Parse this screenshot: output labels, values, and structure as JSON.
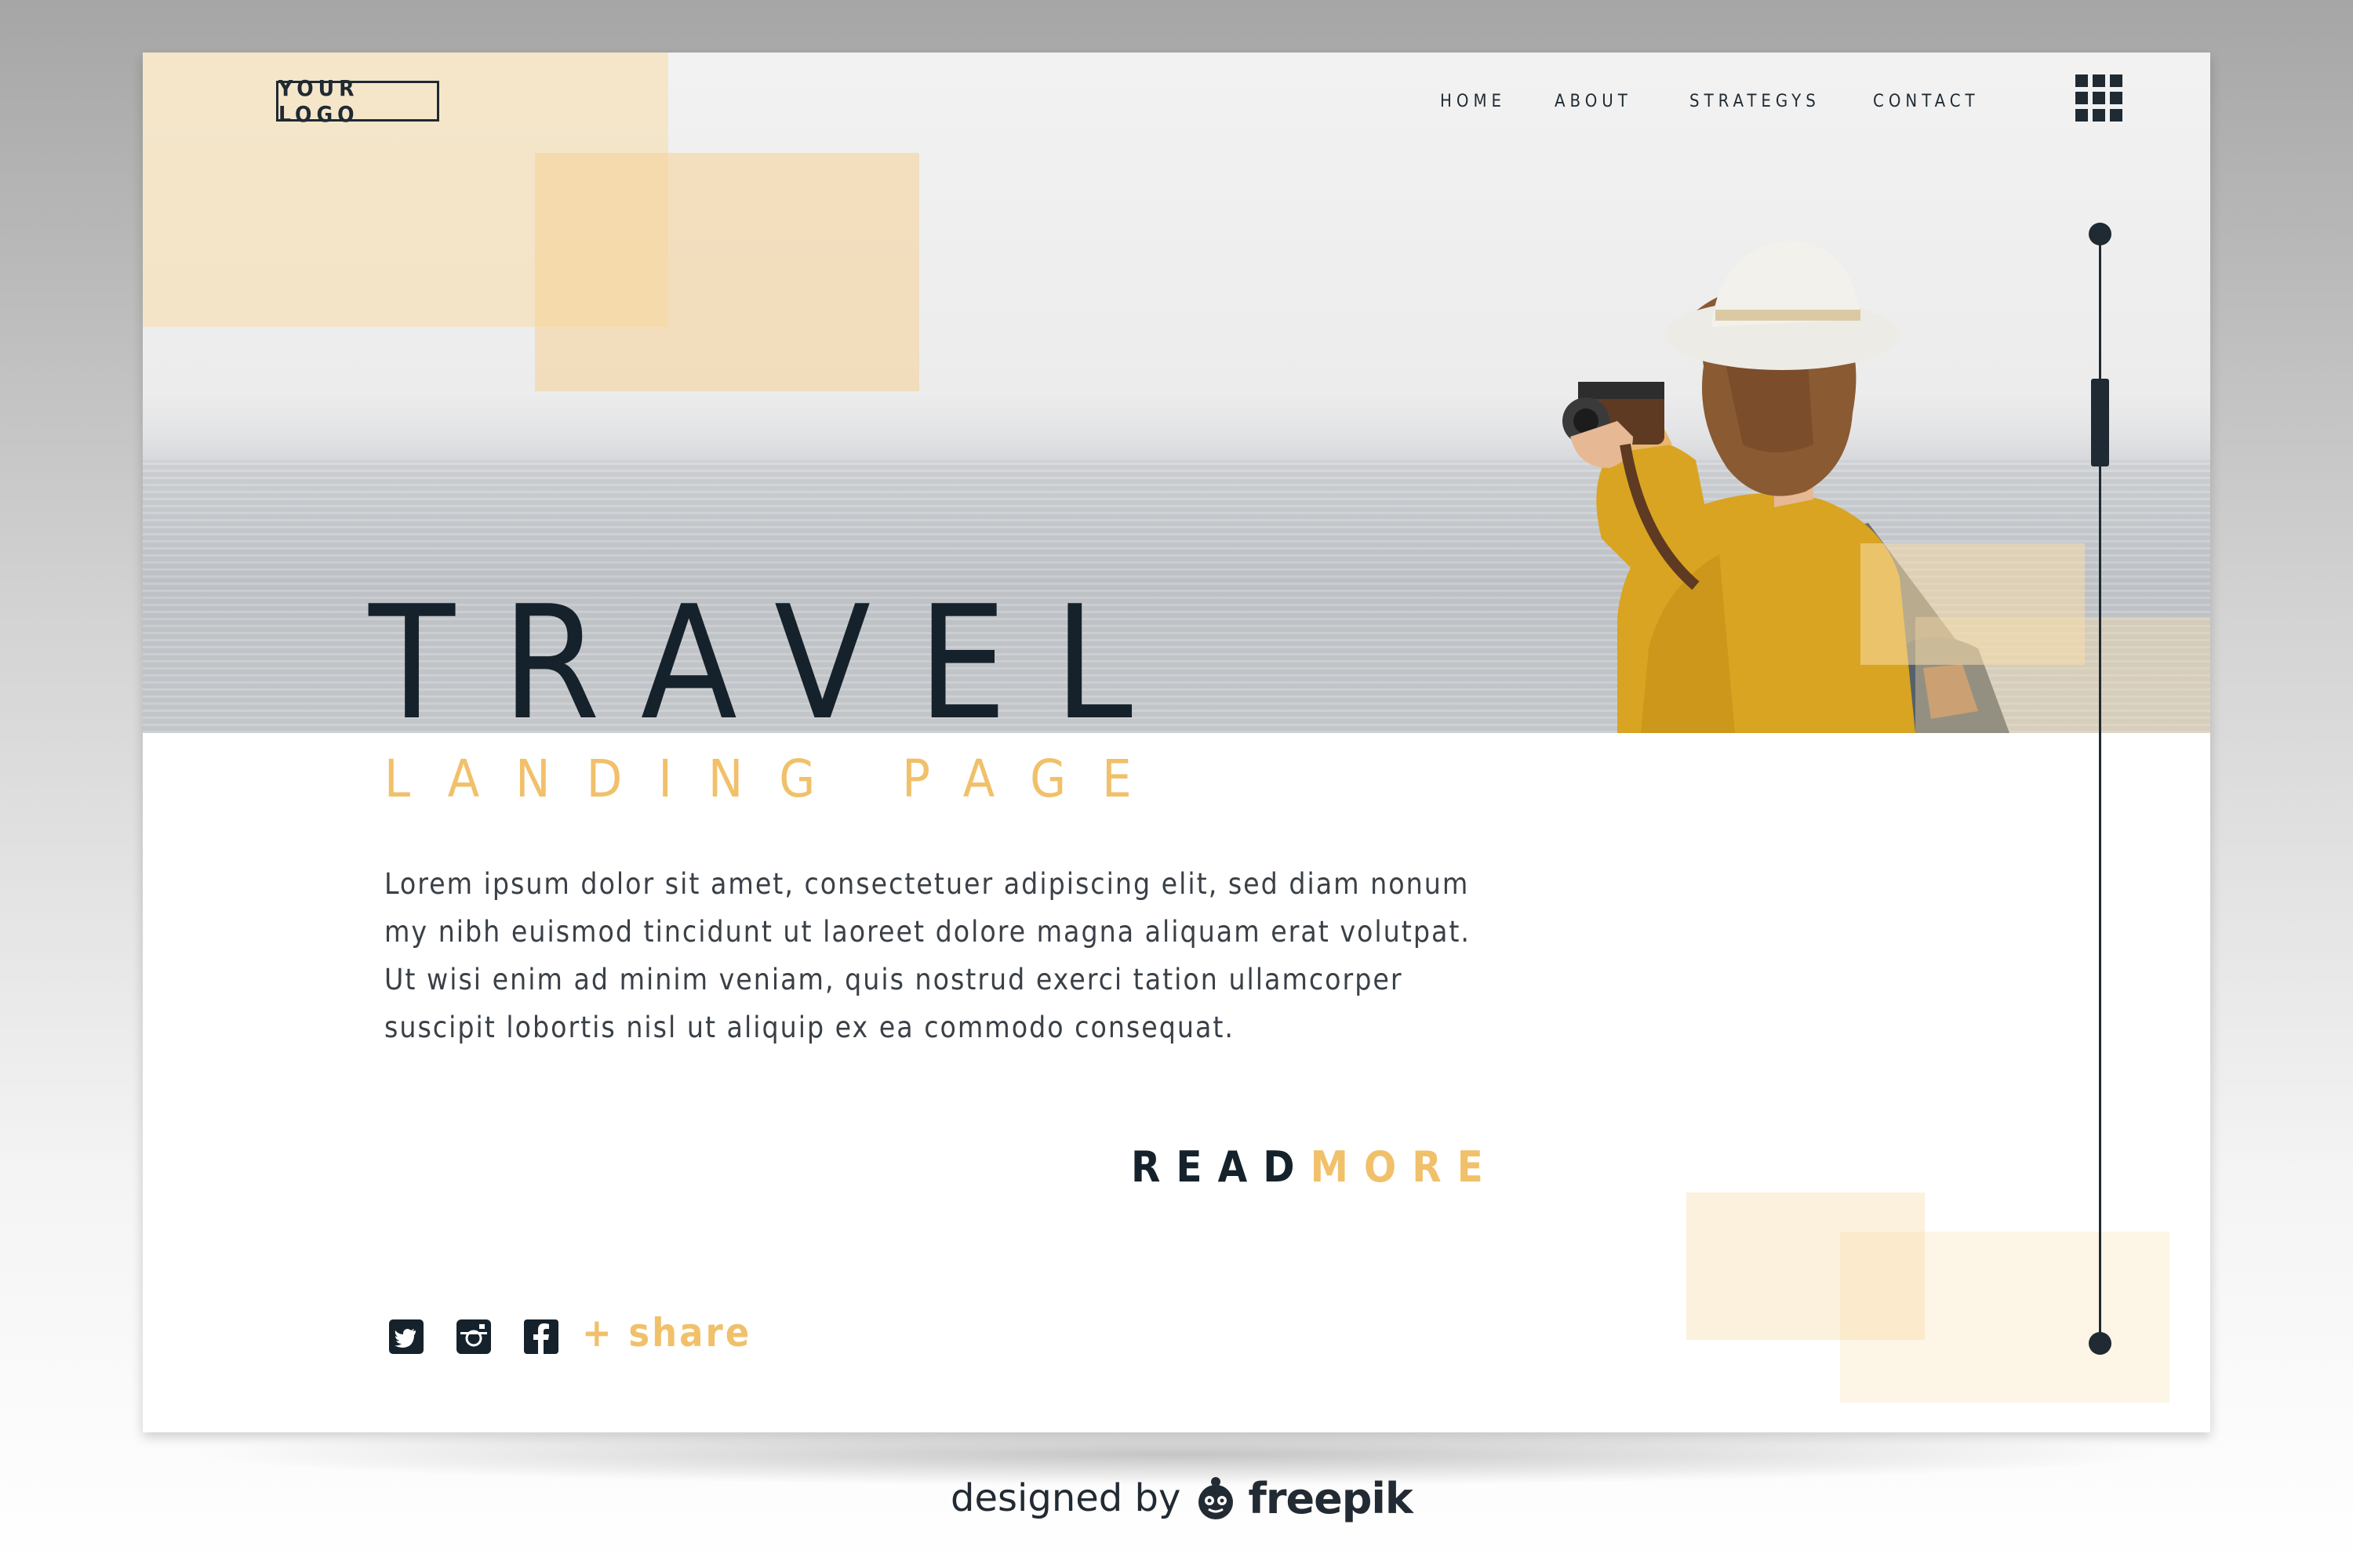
{
  "logo": {
    "text": "YOUR LOGO"
  },
  "nav": {
    "items": [
      {
        "label": "HOME"
      },
      {
        "label": "ABOUT"
      },
      {
        "label": "STRATEGYS"
      },
      {
        "label": "CONTACT"
      }
    ],
    "menu_icon": "grid-menu-icon"
  },
  "hero": {
    "title": "TRAVEL",
    "subtitle": "LANDING PAGE",
    "body": "Lorem ipsum dolor sit amet, consectetuer adipiscing elit, sed diam nonum my nibh euismod tincidunt ut laoreet dolore magna aliquam erat volutpat. Ut wisi enim ad minim veniam, quis nostrud exerci tation ullamcorper suscipit lobortis nisl ut aliquip ex ea commodo consequat.",
    "read_more": {
      "part1": "READ",
      "part2": "MORE"
    },
    "photo": "woman-with-camera-photo"
  },
  "social": {
    "icons": [
      "twitter-icon",
      "instagram-icon",
      "facebook-icon"
    ],
    "share_label": "+ share"
  },
  "credit": {
    "prefix": "designed by",
    "brand": "freepik",
    "icon": "freepik-mascot-icon"
  },
  "colors": {
    "accent": "#f1c06a",
    "dark": "#16222b",
    "peach": "#f8ddaa"
  }
}
